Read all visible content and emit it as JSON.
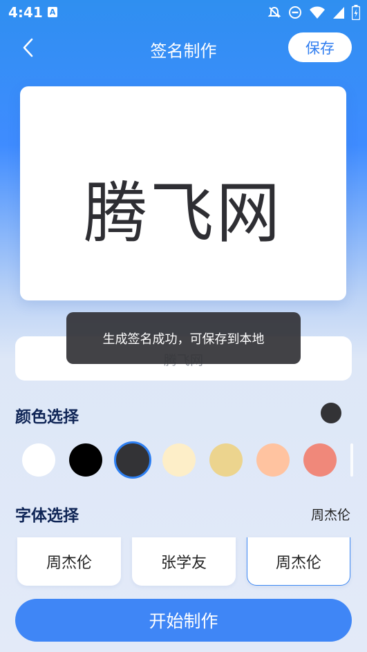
{
  "status_bar": {
    "time": "4:41",
    "notification_icon": "A"
  },
  "nav": {
    "title": "签名制作",
    "save_label": "保存",
    "back_icon": "chevron-left-icon"
  },
  "preview": {
    "signature_text": "腾飞网"
  },
  "input": {
    "value": "腾飞网"
  },
  "toast": {
    "message": "生成签名成功，可保存到本地"
  },
  "color_section": {
    "title": "颜色选择",
    "selected_color": "#333336",
    "swatches": [
      "#ffffff",
      "#000000",
      "#333336",
      "#fdeec8",
      "#ecd48e",
      "#ffc3a0",
      "#f0887a"
    ],
    "selected_index": 2
  },
  "font_section": {
    "title": "字体选择",
    "current": "周杰伦",
    "options": [
      "周杰伦",
      "张学友",
      "周杰伦"
    ],
    "selected_index": 2
  },
  "start_button": {
    "label": "开始制作"
  },
  "colors": {
    "accent": "#3f86f6",
    "primary_blue": "#2f8ff0"
  }
}
